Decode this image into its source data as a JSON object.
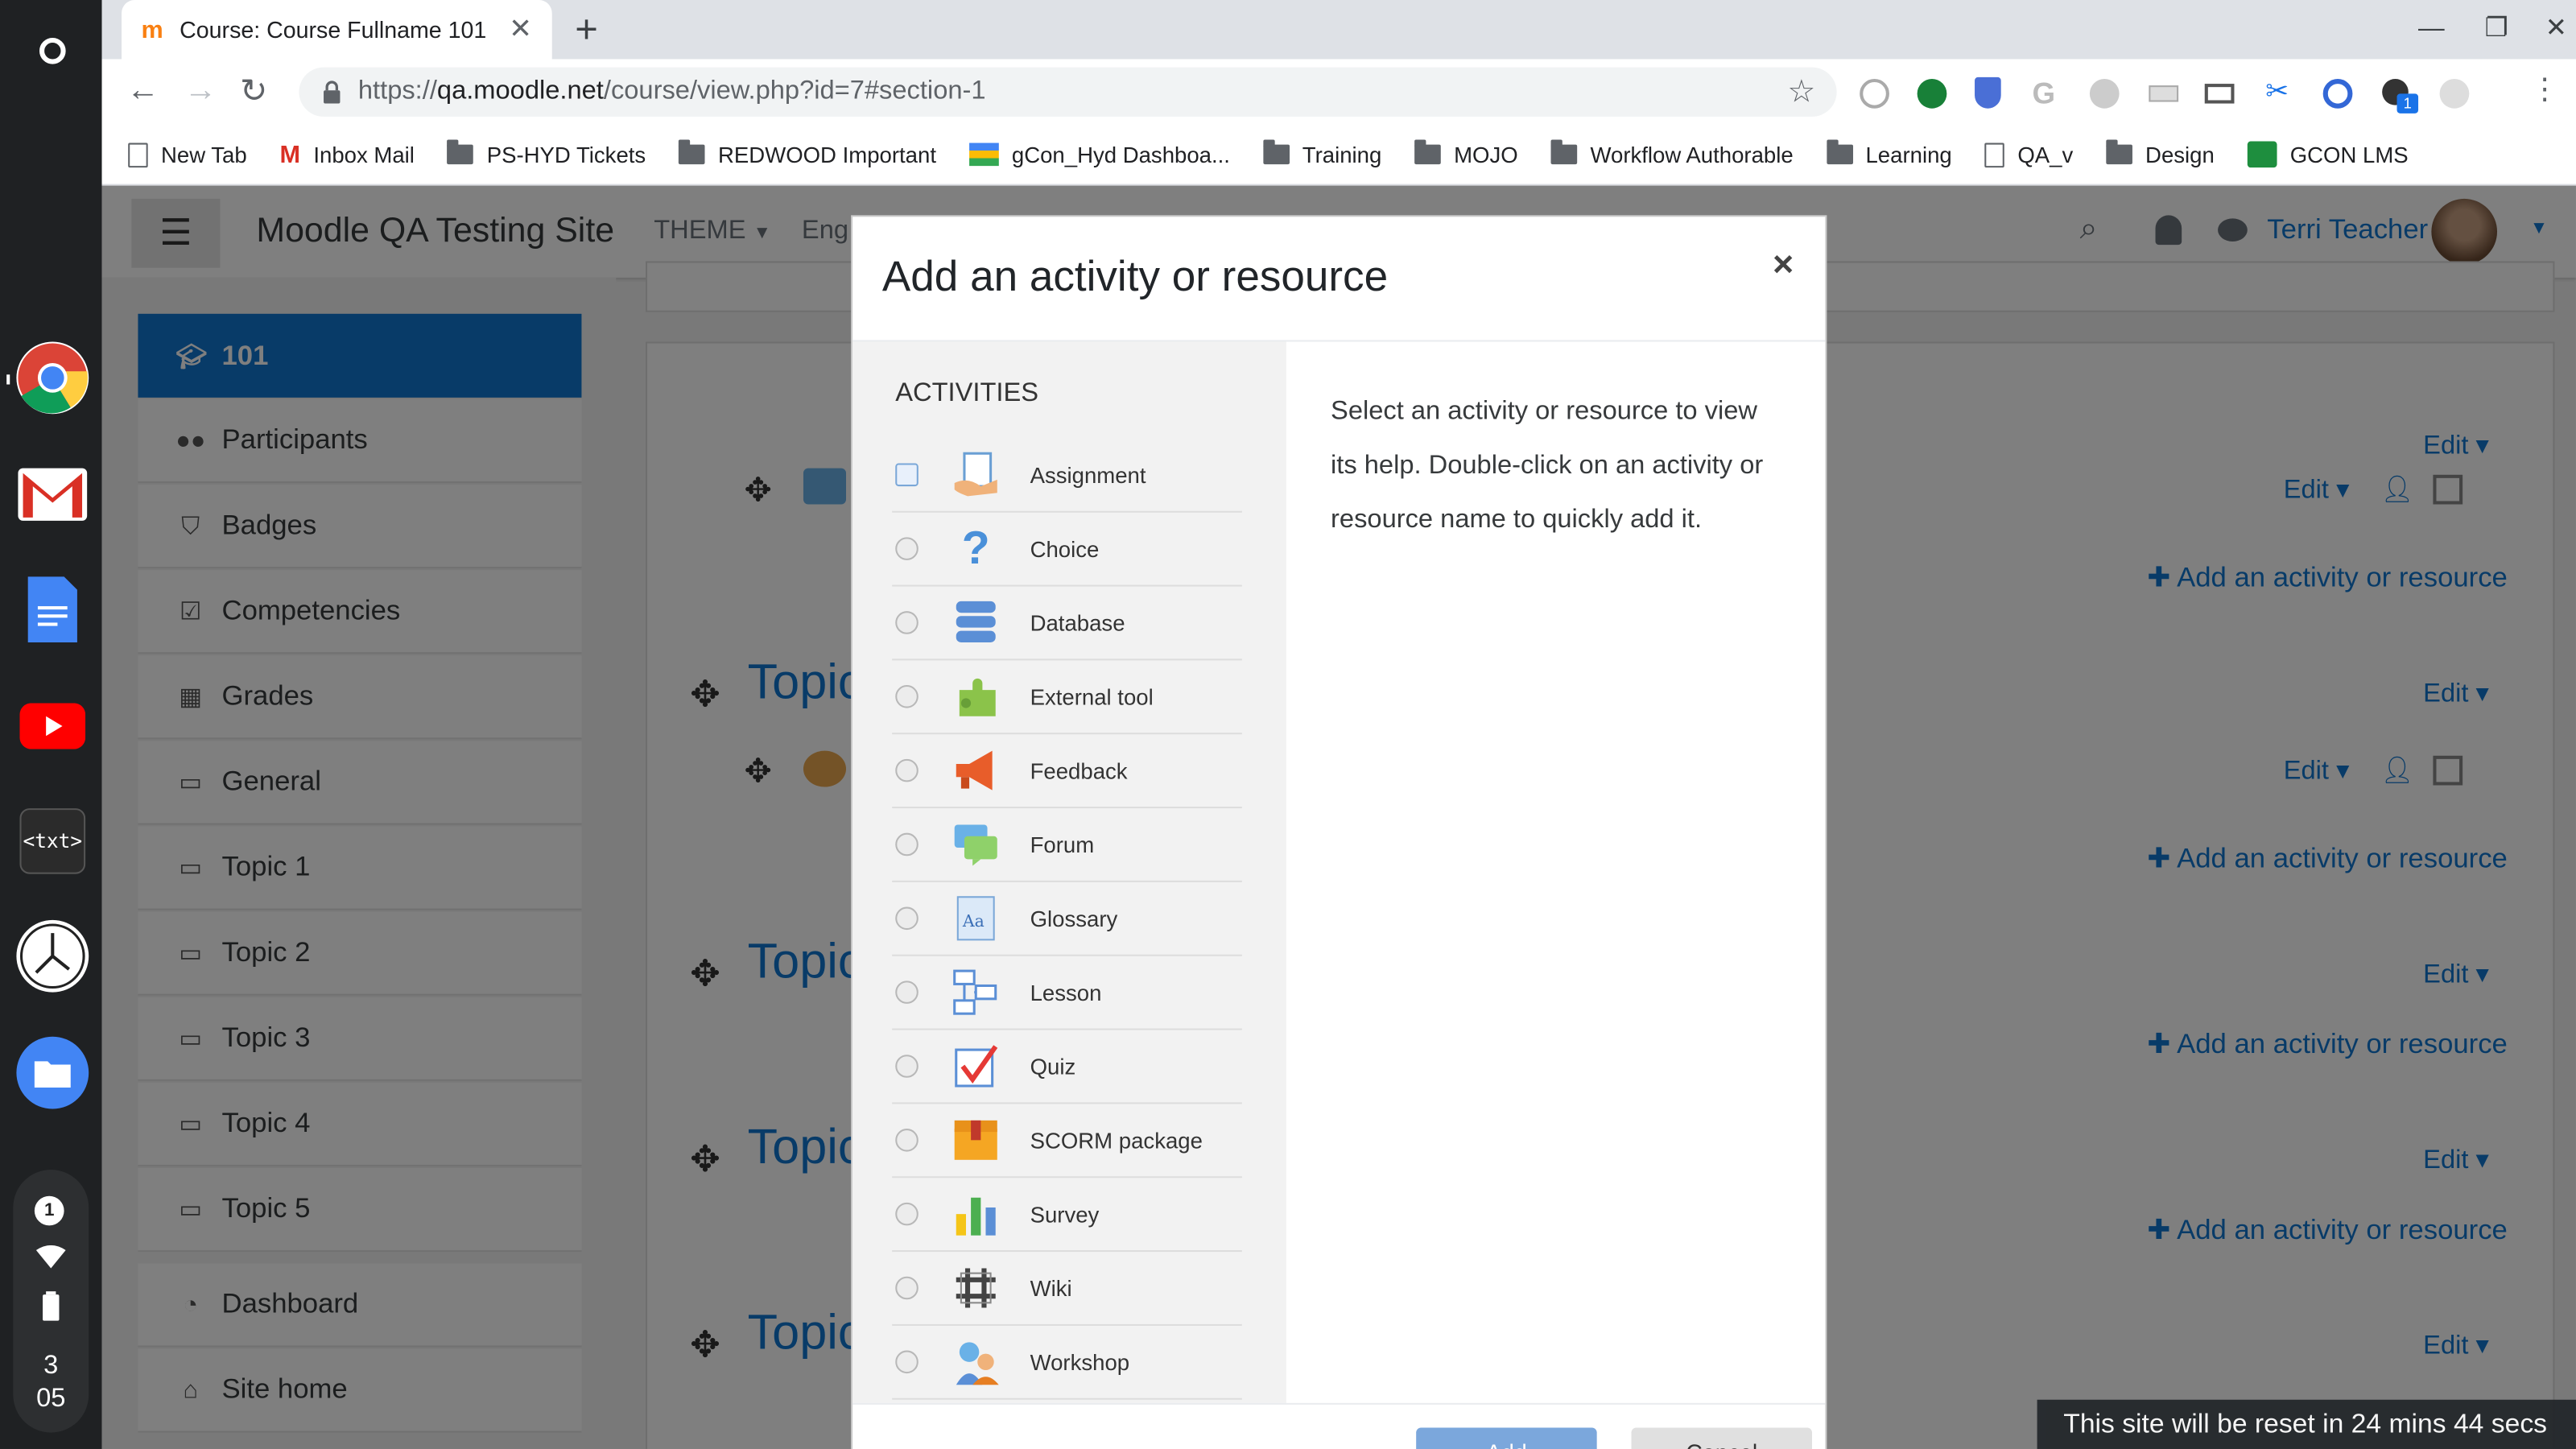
{
  "browser": {
    "tab_title": "Course: Course Fullname 101",
    "url": "https://qa.moodle.net/course/view.php?id=7#section-1",
    "url_host": "qa.moodle.net",
    "url_prefix": "https://",
    "url_rest": "/course/view.php?id=7#section-1",
    "extension_badge": "1",
    "bookmarks": [
      {
        "label": "New Tab",
        "icon": "page-icon"
      },
      {
        "label": "Inbox Mail",
        "icon": "gmail-icon"
      },
      {
        "label": "PS-HYD Tickets",
        "icon": "folder-icon"
      },
      {
        "label": "REDWOOD Important",
        "icon": "folder-icon"
      },
      {
        "label": "gCon_Hyd Dashboa...",
        "icon": "dashboard-icon"
      },
      {
        "label": "Training",
        "icon": "folder-icon"
      },
      {
        "label": "MOJO",
        "icon": "folder-icon"
      },
      {
        "label": "Workflow Authorable",
        "icon": "folder-icon"
      },
      {
        "label": "Learning",
        "icon": "folder-icon"
      },
      {
        "label": "QA_v",
        "icon": "page-icon"
      },
      {
        "label": "Design",
        "icon": "folder-icon"
      },
      {
        "label": "GCON LMS",
        "icon": "classroom-icon"
      }
    ]
  },
  "shelf": {
    "notification_count": "1",
    "time_hour": "3",
    "time_minute": "05",
    "txt_app_label": "<txt>"
  },
  "moodle": {
    "site_name": "Moodle QA Testing Site",
    "theme_menu": "THEME",
    "lang_menu": "Eng",
    "user_name": "Terri Teacher",
    "drawer": [
      {
        "label": "101",
        "icon": "mortarboard-icon",
        "active": true
      },
      {
        "label": "Participants",
        "icon": "users-icon"
      },
      {
        "label": "Badges",
        "icon": "shield-icon"
      },
      {
        "label": "Competencies",
        "icon": "checkbox-icon"
      },
      {
        "label": "Grades",
        "icon": "table-icon"
      },
      {
        "label": "General",
        "icon": "folder-icon"
      },
      {
        "label": "Topic 1",
        "icon": "folder-icon"
      },
      {
        "label": "Topic 2",
        "icon": "folder-icon"
      },
      {
        "label": "Topic 3",
        "icon": "folder-icon"
      },
      {
        "label": "Topic 4",
        "icon": "folder-icon"
      },
      {
        "label": "Topic 5",
        "icon": "folder-icon"
      }
    ],
    "drawer_bottom": [
      {
        "label": "Dashboard",
        "icon": "dashboard-icon"
      },
      {
        "label": "Site home",
        "icon": "home-icon"
      }
    ],
    "topic_word": "Topic",
    "edit_label": "Edit",
    "add_activity_label": "Add an activity or resource"
  },
  "modal": {
    "title": "Add an activity or resource",
    "close_label": "×",
    "section_heading": "ACTIVITIES",
    "help_text": "Select an activity or resource to view its help. Double-click on an activity or resource name to quickly add it.",
    "add_button": "Add",
    "cancel_button": "Cancel",
    "activities": [
      {
        "label": "Assignment",
        "icon": "assignment-icon"
      },
      {
        "label": "Choice",
        "icon": "choice-icon"
      },
      {
        "label": "Database",
        "icon": "database-icon"
      },
      {
        "label": "External tool",
        "icon": "external-tool-icon"
      },
      {
        "label": "Feedback",
        "icon": "feedback-icon"
      },
      {
        "label": "Forum",
        "icon": "forum-icon"
      },
      {
        "label": "Glossary",
        "icon": "glossary-icon"
      },
      {
        "label": "Lesson",
        "icon": "lesson-icon"
      },
      {
        "label": "Quiz",
        "icon": "quiz-icon"
      },
      {
        "label": "SCORM package",
        "icon": "scorm-icon"
      },
      {
        "label": "Survey",
        "icon": "survey-icon"
      },
      {
        "label": "Wiki",
        "icon": "wiki-icon"
      },
      {
        "label": "Workshop",
        "icon": "workshop-icon"
      }
    ]
  },
  "reset_banner": "This site will be reset in 24 mins 44 secs",
  "colors": {
    "moodle_blue": "#1177d1",
    "drawer_active": "#1177d1",
    "overlay": "rgba(0,0,0,0.5)"
  }
}
